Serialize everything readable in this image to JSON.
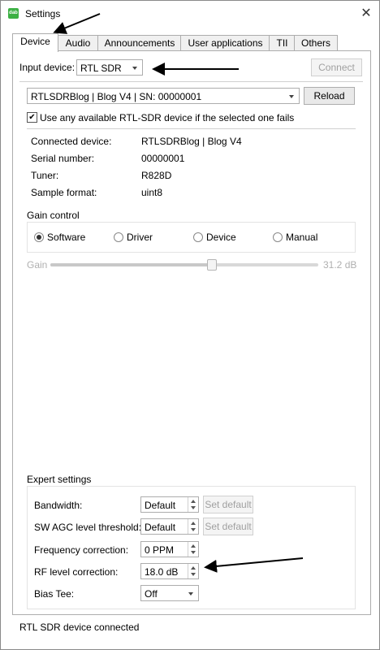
{
  "window": {
    "title": "Settings",
    "icon_label": "dab"
  },
  "tabs": [
    {
      "label": "Device",
      "active": true
    },
    {
      "label": "Audio"
    },
    {
      "label": "Announcements"
    },
    {
      "label": "User applications"
    },
    {
      "label": "TII"
    },
    {
      "label": "Others"
    }
  ],
  "input_device": {
    "label": "Input device:",
    "value": "RTL SDR",
    "connect_label": "Connect"
  },
  "device_select": {
    "value": "RTLSDRBlog | Blog V4 | SN: 00000001",
    "reload_label": "Reload",
    "fallback_checked": true,
    "fallback_label": "Use any available RTL-SDR device if the selected one fails"
  },
  "info": {
    "connected_device_label": "Connected device:",
    "connected_device_value": "RTLSDRBlog | Blog V4",
    "serial_label": "Serial number:",
    "serial_value": "00000001",
    "tuner_label": "Tuner:",
    "tuner_value": "R828D",
    "sample_format_label": "Sample format:",
    "sample_format_value": "uint8"
  },
  "gain": {
    "title": "Gain control",
    "options": [
      "Software",
      "Driver",
      "Device",
      "Manual"
    ],
    "selected": "Software",
    "slider_label": "Gain",
    "slider_value_text": "31.2 dB",
    "slider_level_fraction": 0.6
  },
  "expert": {
    "title": "Expert settings",
    "bandwidth_label": "Bandwidth:",
    "bandwidth_value": "Default",
    "agc_label": "SW AGC level threshold:",
    "agc_value": "Default",
    "set_default_label": "Set default",
    "freq_corr_label": "Frequency correction:",
    "freq_corr_value": "0 PPM",
    "rf_level_label": "RF level correction:",
    "rf_level_value": "18.0 dB",
    "bias_tee_label": "Bias Tee:",
    "bias_tee_value": "Off"
  },
  "status": {
    "text": "RTL SDR device connected"
  }
}
